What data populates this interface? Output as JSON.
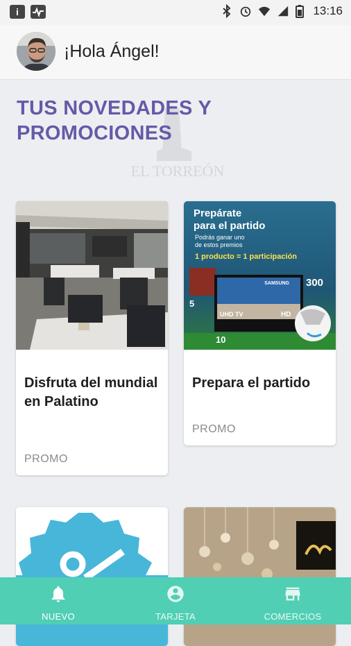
{
  "status_bar": {
    "time": "13:16",
    "icons": [
      "info-icon",
      "activity-icon",
      "bluetooth-icon",
      "alarm-icon",
      "wifi-icon",
      "signal-icon",
      "battery-icon"
    ]
  },
  "header": {
    "greeting": "¡Hola Ángel!"
  },
  "section": {
    "title": "TUS NOVEDADES Y PROMOCIONES",
    "watermark": "EL TORREÓN"
  },
  "cards": [
    {
      "title": "Disfruta del mundial en Palatino",
      "tag": "PROMO"
    },
    {
      "title": "Prepara el partido",
      "tag": "PROMO",
      "image_text": {
        "headline_1": "Prepárate",
        "headline_2": "para el partido",
        "sub_1": "Podrás ganar uno",
        "sub_2": "de estos premios",
        "rule": "1 producto = 1 participación",
        "tv_brand": "SAMSUNG",
        "tv_uhd": "UHD TV",
        "tv_hd": "HD",
        "prize_300": "300",
        "prize_5": "5",
        "prize_10": "10"
      }
    },
    {
      "title": "",
      "tag": ""
    },
    {
      "title": "",
      "tag": ""
    }
  ],
  "bottom_nav": {
    "items": [
      {
        "label": "NUEVO",
        "icon": "bell-icon",
        "active": true
      },
      {
        "label": "TARJETA",
        "icon": "account-circle-icon",
        "active": false
      },
      {
        "label": "COMERCIOS",
        "icon": "store-icon",
        "active": false
      }
    ]
  },
  "colors": {
    "accent": "#6659a8",
    "nav": "#50cfb5",
    "background": "#eceef1"
  }
}
